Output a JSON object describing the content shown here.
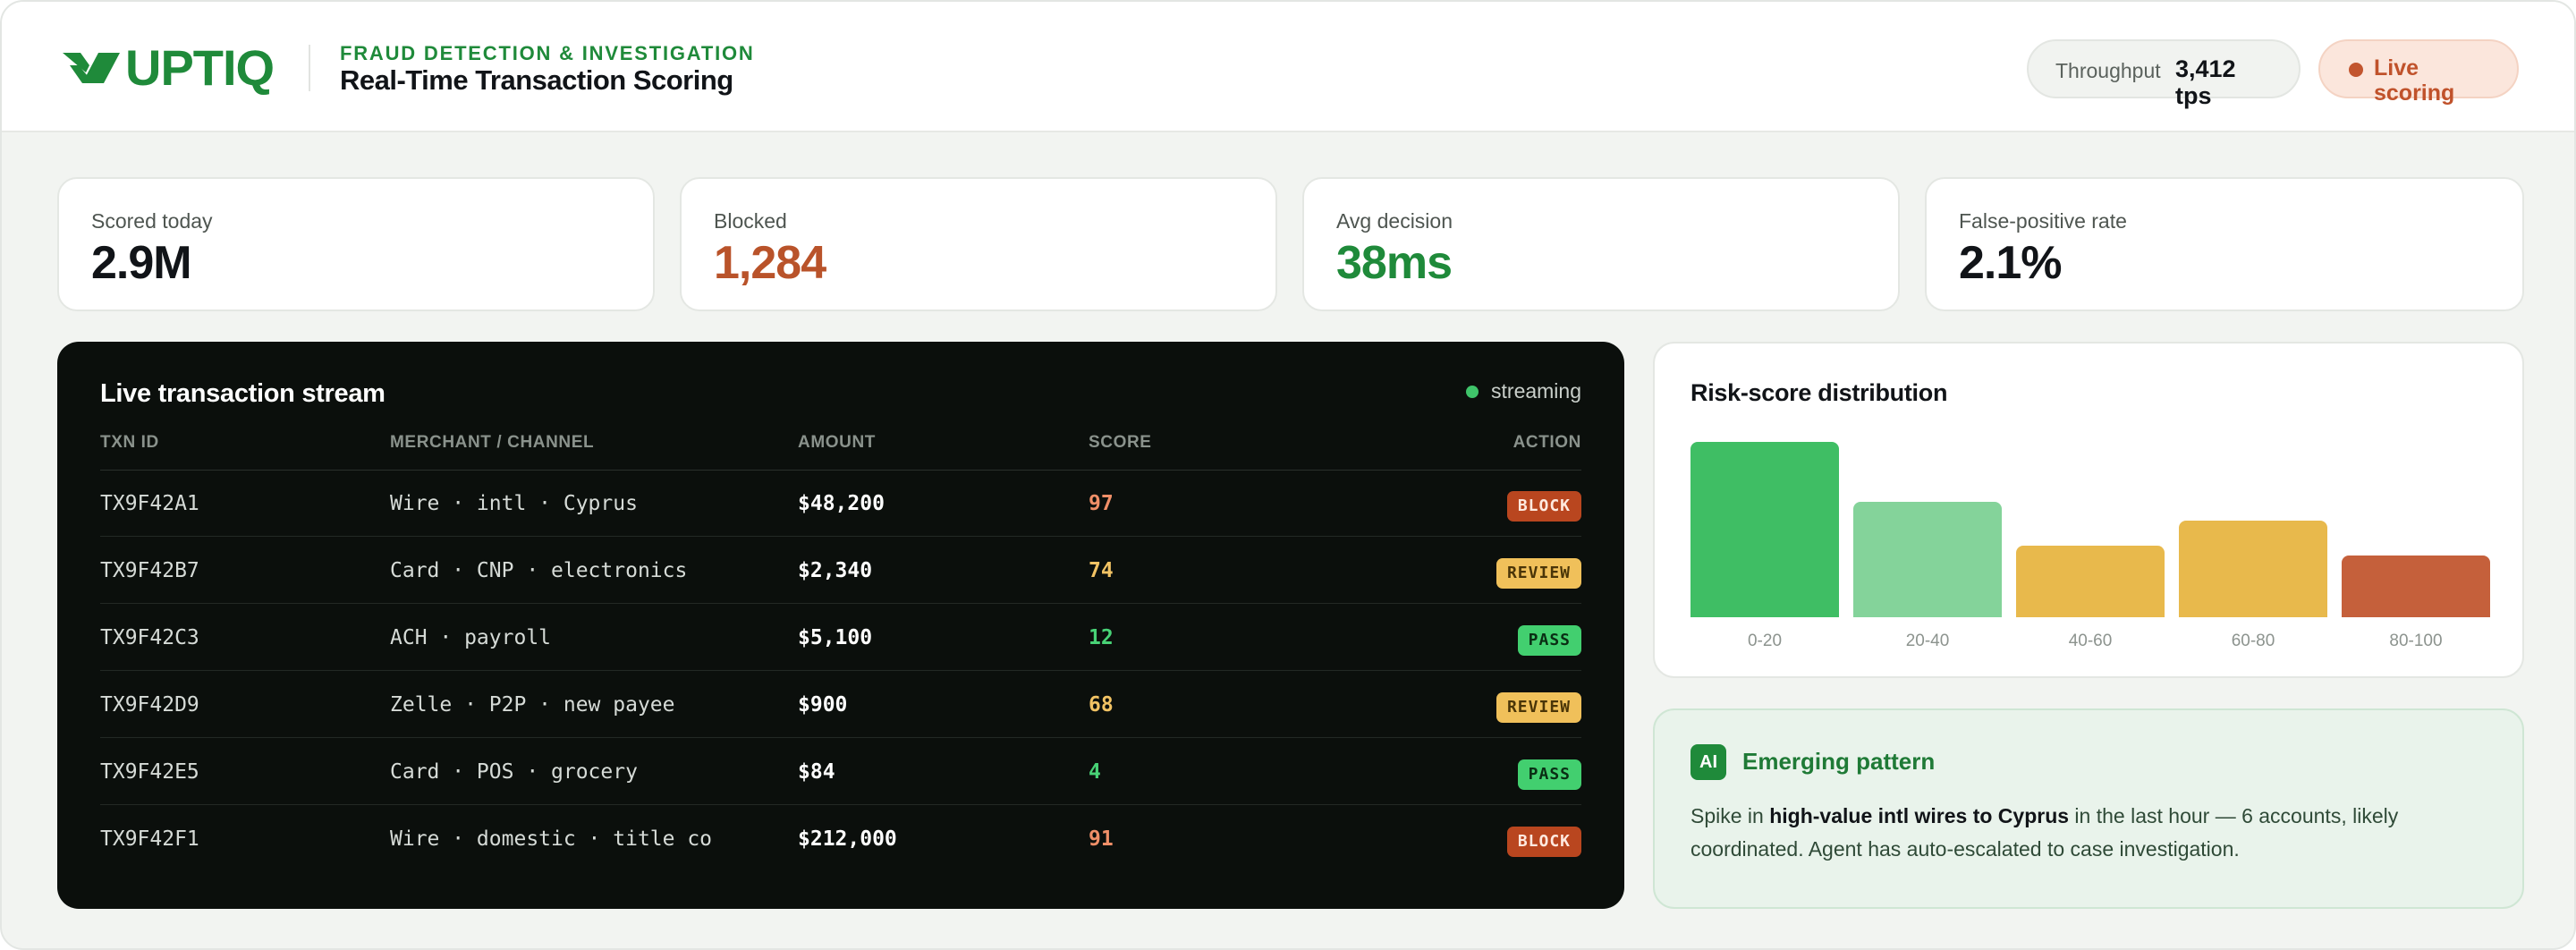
{
  "header": {
    "brand": "UPTIQ",
    "eyebrow": "FRAUD DETECTION & INVESTIGATION",
    "title": "Real-Time Transaction Scoring",
    "throughput_label": "Throughput",
    "throughput_value": "3,412 tps",
    "live_label": "Live scoring"
  },
  "stats": [
    {
      "label": "Scored today",
      "value": "2.9M",
      "color": "#111418"
    },
    {
      "label": "Blocked",
      "value": "1,284",
      "color": "#b9532a"
    },
    {
      "label": "Avg decision",
      "value": "38ms",
      "color": "#1f8a3a"
    },
    {
      "label": "False-positive rate",
      "value": "2.1%",
      "color": "#111418"
    }
  ],
  "stream": {
    "title": "Live transaction stream",
    "status": "streaming",
    "columns": [
      "TXN ID",
      "MERCHANT / CHANNEL",
      "AMOUNT",
      "SCORE",
      "ACTION"
    ],
    "rows": [
      {
        "id": "TX9F42A1",
        "merchant": "Wire · intl · Cyprus",
        "amount": "$48,200",
        "score": "97",
        "action": "BLOCK"
      },
      {
        "id": "TX9F42B7",
        "merchant": "Card · CNP · electronics",
        "amount": "$2,340",
        "score": "74",
        "action": "REVIEW"
      },
      {
        "id": "TX9F42C3",
        "merchant": "ACH · payroll",
        "amount": "$5,100",
        "score": "12",
        "action": "PASS"
      },
      {
        "id": "TX9F42D9",
        "merchant": "Zelle · P2P · new payee",
        "amount": "$900",
        "score": "68",
        "action": "REVIEW"
      },
      {
        "id": "TX9F42E5",
        "merchant": "Card · POS · grocery",
        "amount": "$84",
        "score": "4",
        "action": "PASS"
      },
      {
        "id": "TX9F42F1",
        "merchant": "Wire · domestic · title co",
        "amount": "$212,000",
        "score": "91",
        "action": "BLOCK"
      }
    ],
    "action_colors": {
      "BLOCK": {
        "bg": "#b9461f",
        "fg": "#ffe9df",
        "score": "#f08f68"
      },
      "REVIEW": {
        "bg": "#f0c05a",
        "fg": "#4a3508",
        "score": "#f2c364"
      },
      "PASS": {
        "bg": "#42cf6f",
        "fg": "#0a2e14",
        "score": "#48d276"
      }
    }
  },
  "distribution": {
    "title": "Risk-score distribution",
    "chart_data": {
      "type": "bar",
      "categories": [
        "0-20",
        "20-40",
        "40-60",
        "60-80",
        "80-100"
      ],
      "values": [
        100,
        66,
        41,
        55,
        35
      ],
      "colors": [
        "#3fbe64",
        "#84d39a",
        "#e8b94c",
        "#e8b94c",
        "#c5603b"
      ],
      "ylim": [
        0,
        100
      ]
    }
  },
  "insight": {
    "badge": "AI",
    "title": "Emerging pattern",
    "body_pre": "Spike in ",
    "body_bold": "high-value intl wires to Cyprus",
    "body_post": " in the last hour — 6 accounts, likely coordinated. Agent has auto-escalated to case investigation."
  }
}
